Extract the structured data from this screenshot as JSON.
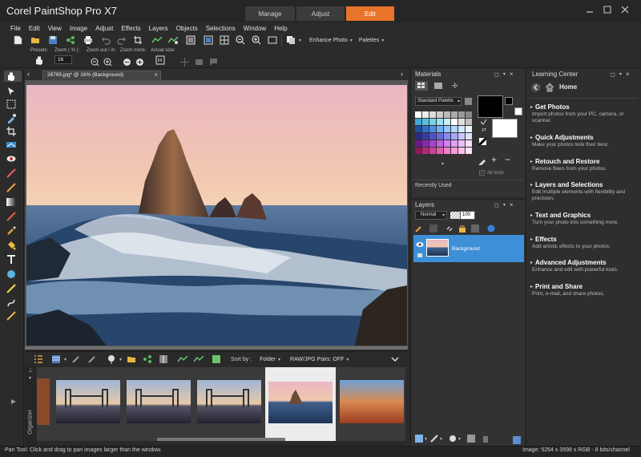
{
  "app": {
    "title": "Corel PaintShop Pro X7"
  },
  "workspace_tabs": [
    {
      "label": "Manage",
      "active": false
    },
    {
      "label": "Adjust",
      "active": false
    },
    {
      "label": "Edit",
      "active": true
    }
  ],
  "menu": [
    "File",
    "Edit",
    "View",
    "Image",
    "Adjust",
    "Effects",
    "Layers",
    "Objects",
    "Selections",
    "Window",
    "Help"
  ],
  "toolbar": {
    "enhance_photo": "Enhance Photo",
    "palettes": "Palettes"
  },
  "tool_options": {
    "presets_label": "Presets:",
    "zoom_pct_label": "Zoom ( % ):",
    "zoom_value": "16",
    "zoom_inout_label": "Zoom out / in:",
    "zoom_more_label": "Zoom more:",
    "actual_size_label": "Actual size:"
  },
  "document": {
    "tab_label": "28765.jpg* @  16% (Background)"
  },
  "materials": {
    "title": "Materials",
    "palette_select": "Standard Palette",
    "all_tools_label": "All tools",
    "recently_used": "Recently Used"
  },
  "layers": {
    "title": "Layers",
    "blend_mode": "Normal",
    "opacity": "100",
    "layer_name": "Background"
  },
  "learning_center": {
    "title": "Learning Center",
    "home_label": "Home",
    "items": [
      {
        "heading": "Get Photos",
        "desc": "Import photos from your PC, camera, or scanner."
      },
      {
        "heading": "Quick Adjustments",
        "desc": "Make your photos look their best."
      },
      {
        "heading": "Retouch and Restore",
        "desc": "Remove flaws from your photos."
      },
      {
        "heading": "Layers and Selections",
        "desc": "Edit multiple elements with flexibility and precision."
      },
      {
        "heading": "Text and Graphics",
        "desc": "Turn your photo into something more."
      },
      {
        "heading": "Effects",
        "desc": "Add artistic effects to your photos."
      },
      {
        "heading": "Advanced Adjustments",
        "desc": "Enhance and edit with powerful tools."
      },
      {
        "heading": "Print and Share",
        "desc": "Print, e-mail, and share photos."
      }
    ]
  },
  "organizer": {
    "label": "Organizer",
    "sort_by_label": "Sort by :",
    "sort_value": "Folder",
    "raw_pairs": "RAW/JPG Pairs: OFF"
  },
  "status": {
    "left": "Pan Tool: Click and drag to pan images larger than the window.",
    "right": "Image:  5264 x 3598 x RGB - 8 bits/channel"
  },
  "colors": {
    "accent": "#e8742a",
    "selection": "#3d8fd8",
    "chrome": "#2b2b2b",
    "panel": "#323232",
    "canvas_bg": "#565656"
  }
}
